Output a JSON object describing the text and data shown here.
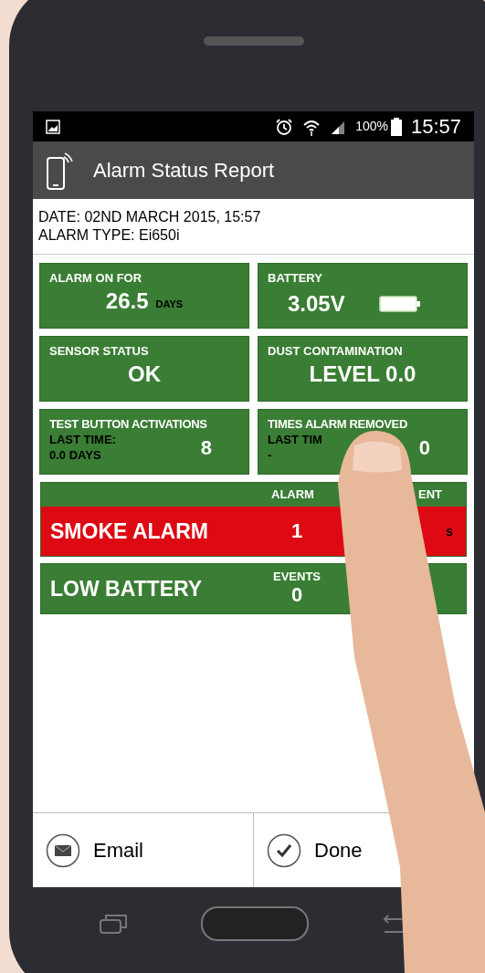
{
  "status_bar": {
    "battery_text": "100%",
    "time": "15:57"
  },
  "app_bar": {
    "title": "Alarm Status Report"
  },
  "report": {
    "date_line": "DATE: 02ND MARCH 2015, 15:57",
    "type_line": "ALARM TYPE: Ei650i"
  },
  "tiles": [
    {
      "kind": "value",
      "label": "ALARM ON FOR",
      "value": "26.5",
      "unit": "DAYS"
    },
    {
      "kind": "battery",
      "label": "BATTERY",
      "value": "3.05V"
    },
    {
      "kind": "value",
      "label": "SENSOR STATUS",
      "value": "OK"
    },
    {
      "kind": "value",
      "label": "DUST CONTAMINATION",
      "value": "LEVEL 0.0"
    },
    {
      "kind": "count",
      "label": "TEST BUTTON ACTIVATIONS",
      "sub_label": "LAST TIME:",
      "sub_value": "0.0 DAYS",
      "value": "8"
    },
    {
      "kind": "count",
      "label": "TIMES ALARM REMOVED",
      "sub_label": "LAST TIM",
      "sub_value": "-",
      "value": "0"
    }
  ],
  "events": [
    {
      "name": "SMOKE ALARM",
      "alarm": true,
      "header_1": "ALARM",
      "header_2": "ENT",
      "count": "1",
      "column_2": "s"
    },
    {
      "name": "LOW BATTERY",
      "alarm": false,
      "header_1": "EVENTS",
      "count": "0"
    }
  ],
  "buttons": [
    {
      "kind": "email",
      "label": "Email"
    },
    {
      "kind": "done",
      "label": "Done"
    }
  ]
}
